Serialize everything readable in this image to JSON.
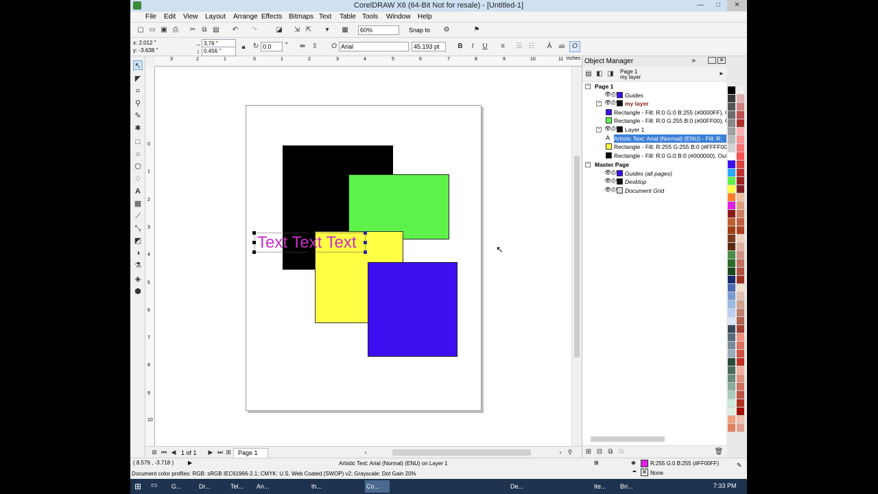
{
  "window": {
    "title": "CorelDRAW X6 (64-Bit Not for resale) - [Untitled-1]",
    "min": "—",
    "max": "□",
    "close": "✕"
  },
  "menu": [
    "File",
    "Edit",
    "View",
    "Layout",
    "Arrange",
    "Effects",
    "Bitmaps",
    "Text",
    "Table",
    "Tools",
    "Window",
    "Help"
  ],
  "toolbar": {
    "zoom": "60%",
    "snap_to": "Snap to"
  },
  "property_bar": {
    "x": "x: 2.012 \"",
    "y": "y: -3.638 \"",
    "w": "3.76 \"",
    "h": "0.456 \"",
    "angle": "0.0",
    "degree": "°",
    "font": "Arial",
    "font_size": "45.193 pt"
  },
  "ruler_units": "inches",
  "ruler_h_ticks": [
    "3",
    "2",
    "1",
    "0",
    "1",
    "2",
    "3",
    "4",
    "5",
    "6",
    "7",
    "8",
    "9",
    "10",
    "11"
  ],
  "ruler_v_ticks": [
    "0",
    "1",
    "2",
    "3",
    "4",
    "5",
    "6",
    "7",
    "8",
    "9",
    "10"
  ],
  "canvas": {
    "artistic_text": "Text Text Text",
    "text_color": "#c82fc8"
  },
  "shapes": {
    "black": "#000000",
    "green": "#5df24a",
    "yellow": "#ffff44",
    "blue": "#3c10ee"
  },
  "nav": {
    "page_count": "1 of 1",
    "page_tab": "Page 1"
  },
  "object_manager": {
    "title": "Object Manager",
    "page_label": "Page 1",
    "layer_label": "my layer",
    "rows": [
      {
        "text": "Page 1",
        "bold": true
      },
      {
        "text": "Guides",
        "italic": true
      },
      {
        "text": "my layer",
        "bold": true,
        "color": "#8b1a1a"
      },
      {
        "text": "Rectangle - Fill: R:0 G:0 B:255 (#0000FF), O"
      },
      {
        "text": "Rectangle - Fill: R:0 G:255 B:0 (#00FF00), O"
      },
      {
        "text": "Layer 1"
      },
      {
        "text": "Artistic Text: Arial (Normal) (ENU) - Fill: R:"
      },
      {
        "text": "Rectangle - Fill: R:255 G:255 B:0 (#FFFF00),"
      },
      {
        "text": "Rectangle - Fill: R:0 G:0 B:0 (#000000), Out"
      },
      {
        "text": "Master Page",
        "bold": true
      },
      {
        "text": "Guides (all pages)",
        "italic": true
      },
      {
        "text": "Desktop",
        "italic": true
      },
      {
        "text": "Document Grid",
        "italic": true
      }
    ]
  },
  "status": {
    "coords": "( 8.579 , -3.718 )",
    "selection": "Artistic Text: Arial (Normal) (ENU) on Layer 1",
    "profiles": "Document color profiles: RGB: sRGB IEC61966-2.1; CMYK: U.S. Web Coated (SWOP) v2; Grayscale: Dot Gain 20%",
    "fill": "R:255 G:0 B:255 (#FF00FF)",
    "outline": "None"
  },
  "taskbar": {
    "items": [
      "G...",
      "Dr...",
      "Tel...",
      "An...",
      "th...",
      "Co...",
      "De...",
      "Ite...",
      "Bri..."
    ],
    "clock": "7:33 PM"
  }
}
